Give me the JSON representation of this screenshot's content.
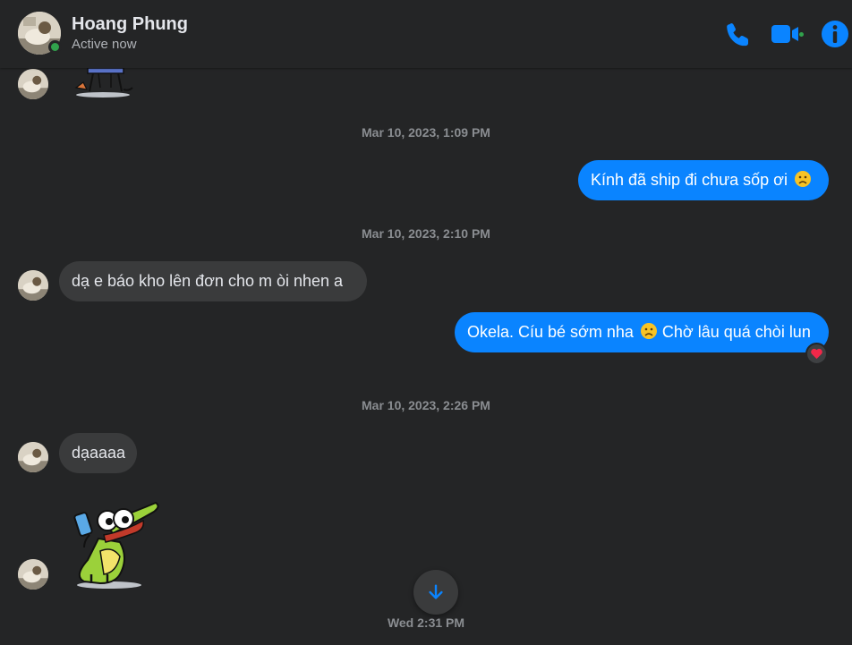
{
  "header": {
    "name": "Hoang Phung",
    "status": "Active now",
    "icons": [
      "phone-icon",
      "video-camera-icon",
      "info-icon"
    ]
  },
  "colors": {
    "background": "#242526",
    "accent": "#0a84ff",
    "incoming_bubble": "#3a3b3c",
    "online": "#31a24c"
  },
  "thread": {
    "timestamps": [
      "Mar 10, 2023, 1:09 PM",
      "Mar 10, 2023, 2:10 PM",
      "Mar 10, 2023, 2:26 PM"
    ],
    "messages": [
      {
        "from": "me",
        "text": "Kính đã ship đi chưa sốp ơi",
        "emoji": "sad-face-emoji"
      },
      {
        "from": "contact",
        "text": "dạ e báo kho lên đơn cho m òi nhen a"
      },
      {
        "from": "me",
        "text": "Okela. Cíu bé sớm nha",
        "emoji": "sad-face-emoji",
        "text_after": "Chờ lâu quá chòi lun",
        "reaction": "heart"
      },
      {
        "from": "contact",
        "text": "dạaaaa"
      }
    ],
    "stickers": [
      "table-sticker",
      "crocodile-phone-sticker"
    ],
    "bottom_time": "Wed 2:31 PM"
  }
}
